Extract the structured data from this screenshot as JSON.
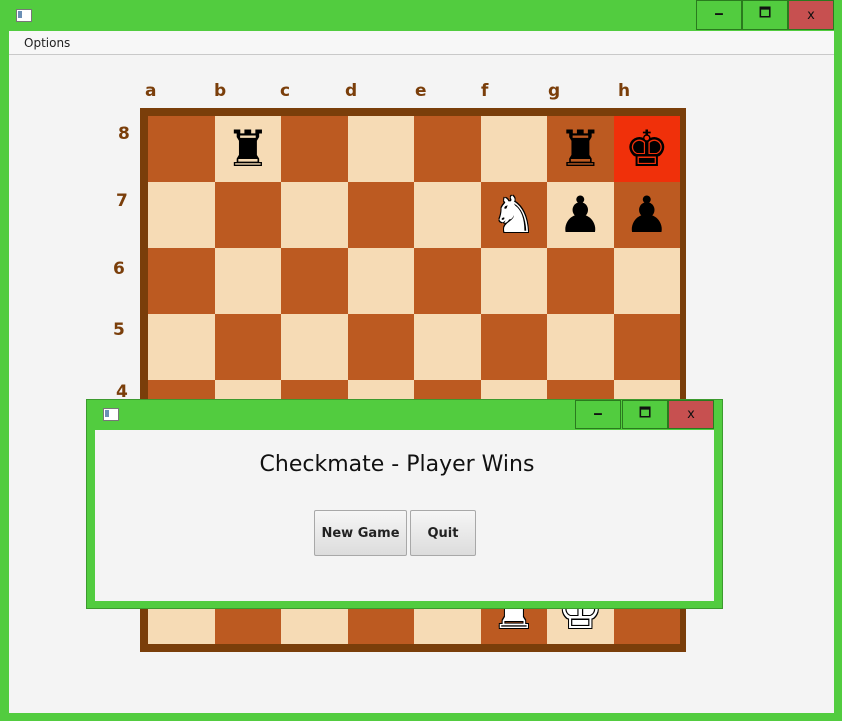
{
  "window": {
    "controls": {
      "minimize": "🗕",
      "maximize": "🗖",
      "close": "x"
    }
  },
  "menu": {
    "options_label": "Options"
  },
  "board": {
    "files": [
      "a",
      "b",
      "c",
      "d",
      "e",
      "f",
      "g",
      "h"
    ],
    "ranks": [
      "8",
      "7",
      "6",
      "5",
      "4"
    ],
    "colors": {
      "light": "#F6DBB5",
      "dark": "#BC5A21",
      "highlight": "#F0300A",
      "frame": "#7A3E0A"
    },
    "pieces": [
      {
        "square": "b8",
        "piece": "rook",
        "color": "black",
        "glyph": "♜"
      },
      {
        "square": "g8",
        "piece": "rook",
        "color": "black",
        "glyph": "♜"
      },
      {
        "square": "h8",
        "piece": "king",
        "color": "black",
        "glyph": "♚",
        "highlight": true
      },
      {
        "square": "f7",
        "piece": "knight",
        "color": "white",
        "glyph": "♞"
      },
      {
        "square": "g7",
        "piece": "pawn",
        "color": "black",
        "glyph": "♟"
      },
      {
        "square": "h7",
        "piece": "pawn",
        "color": "black",
        "glyph": "♟"
      },
      {
        "square": "f1",
        "piece": "rook",
        "color": "white",
        "glyph": "♜"
      },
      {
        "square": "g1",
        "piece": "king",
        "color": "white",
        "glyph": "♚"
      }
    ]
  },
  "dialog": {
    "message": "Checkmate - Player Wins",
    "buttons": {
      "new_game": "New Game",
      "quit": "Quit"
    },
    "controls": {
      "minimize": "🗕",
      "maximize": "🗖",
      "close": "x"
    }
  }
}
